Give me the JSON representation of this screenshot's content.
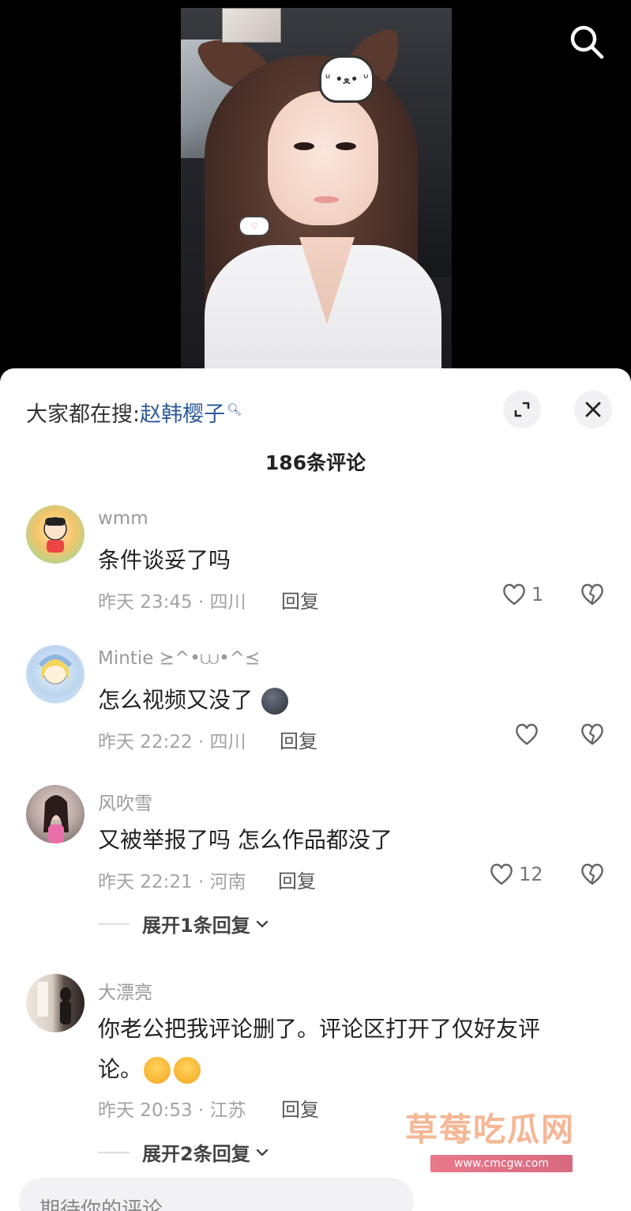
{
  "header": {
    "search_icon": "search-icon"
  },
  "sheet": {
    "hot_search_prefix": "大家都在搜:",
    "hot_search_keyword": "赵韩樱子",
    "expand_icon": "expand-icon",
    "close_icon": "close-icon",
    "comment_count": "186条评论"
  },
  "comments": [
    {
      "username": "wmm",
      "text": "条件谈妥了吗",
      "meta": "昨天 23:45 · 四川",
      "reply_label": "回复",
      "likes": "1"
    },
    {
      "username": "Mintie ⪰^•⩊•^⪯",
      "text": "怎么视频又没了",
      "meta": "昨天 22:22 · 四川",
      "reply_label": "回复",
      "likes": ""
    },
    {
      "username": "风吹雪",
      "text": "又被举报了吗 怎么作品都没了",
      "meta": "昨天 22:21 · 河南",
      "reply_label": "回复",
      "likes": "12",
      "expand_label": "展开1条回复"
    },
    {
      "username": "大漂亮",
      "text_line1": "你老公把我评论删了。评论区打开了仅好友评",
      "text_line2": "论。",
      "meta": "昨天 20:53 · 江苏",
      "reply_label": "回复",
      "expand_label": "展开2条回复"
    }
  ],
  "input": {
    "placeholder": "期待你的评论"
  },
  "watermark": {
    "title": "草莓吃瓜网",
    "url": "www.cmcgw.com"
  }
}
